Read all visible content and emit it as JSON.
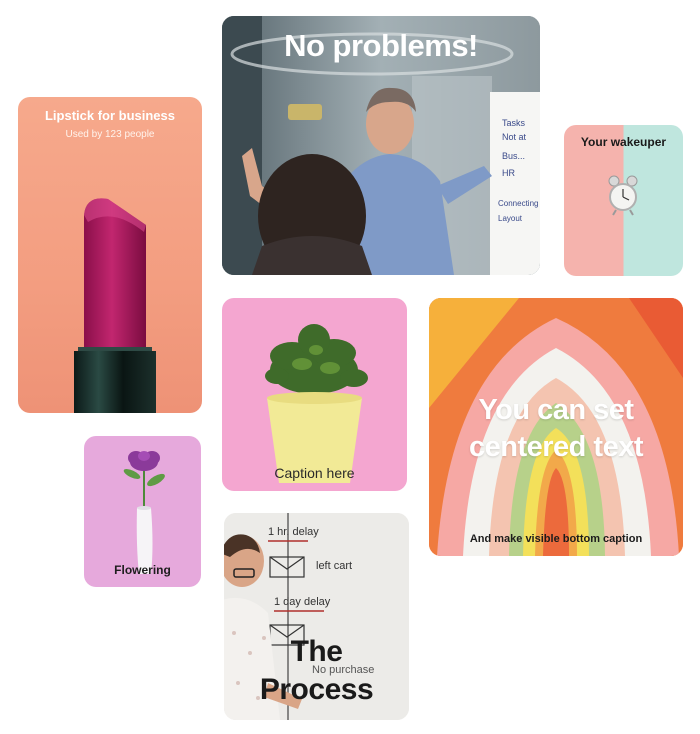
{
  "cards": {
    "lipstick": {
      "title": "Lipstick for business",
      "subtitle": "Used by 123 people"
    },
    "meeting": {
      "title": "No problems!"
    },
    "wakeuper": {
      "title": "Your wakeuper"
    },
    "plant": {
      "caption": "Caption here"
    },
    "colorful": {
      "headline_line1": "You can set",
      "headline_line2": "centered text",
      "bottom_caption": "And make visible bottom caption"
    },
    "flower": {
      "caption": "Flowering"
    },
    "process": {
      "headline_line1": "The",
      "headline_line2": "Process"
    }
  },
  "whiteboard": {
    "items": [
      "1 hr. delay",
      "left cart",
      "1 day delay",
      "No purchase"
    ]
  },
  "flipchart": {
    "lines": [
      "Tasks",
      "Not at",
      "Bus...",
      "HR",
      "Connecting",
      "Layout"
    ]
  },
  "colors": {
    "lipstick_bg": "#f39d80",
    "plant_bg": "#f4a6d0",
    "flower_bg": "#e6a9dc",
    "colorful_outer": "#ef7b3e"
  }
}
